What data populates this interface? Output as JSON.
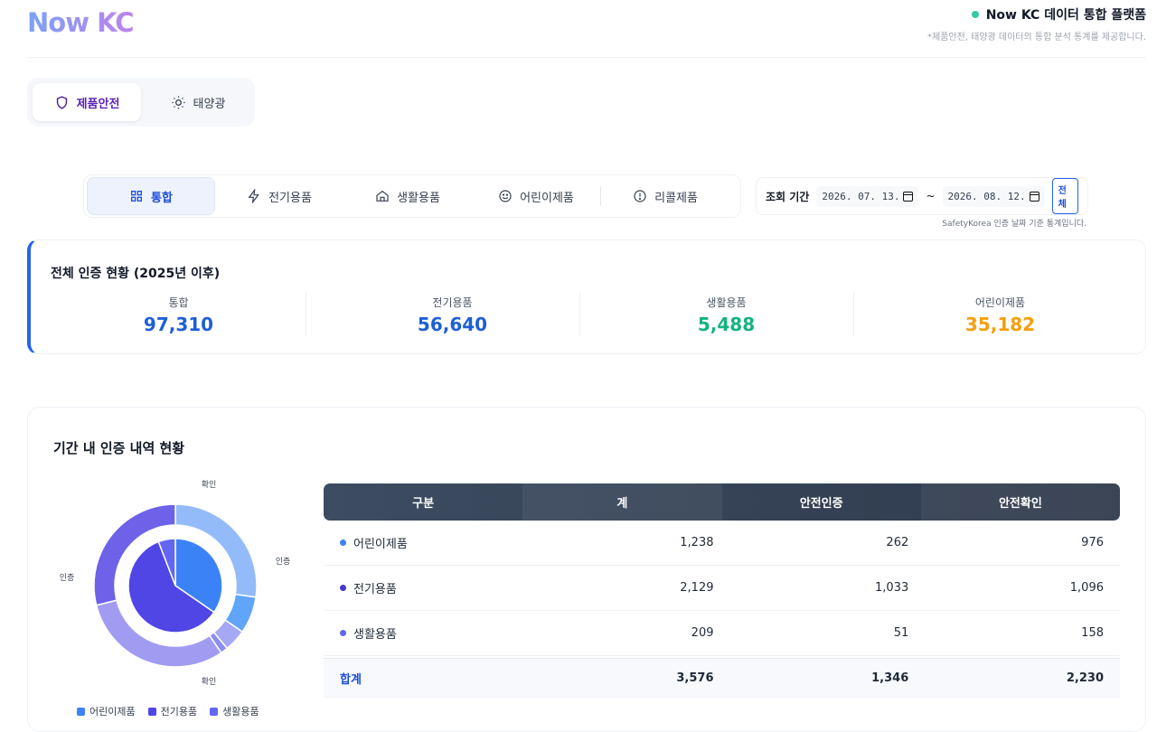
{
  "header": {
    "logo": "Now KC",
    "platform": "Now KC 데이터 통합 플랫폼",
    "subtitle": "*제품안전, 태양광 데이터의 통합 분석 통계를 제공합니다."
  },
  "domain_tabs": [
    {
      "label": "제품안전",
      "icon": "shield-icon",
      "active": true
    },
    {
      "label": "태양광",
      "icon": "sun-icon",
      "active": false
    }
  ],
  "category_tabs": [
    {
      "label": "통합",
      "icon": "grid-icon",
      "active": true
    },
    {
      "label": "전기용품",
      "icon": "lightning-icon"
    },
    {
      "label": "생활용품",
      "icon": "home-icon"
    },
    {
      "label": "어린이제품",
      "icon": "smile-icon"
    },
    {
      "label": "리콜제품",
      "icon": "alert-icon"
    }
  ],
  "period": {
    "label": "조회 기간",
    "start": "2026. 07. 13.",
    "end": "2026. 08. 12.",
    "separator": "~",
    "all_button": "전체",
    "note": "SafetyKorea 인증 날짜 기준 통계입니다."
  },
  "summary": {
    "title": "전체 인증 현황 (2025년 이후)",
    "stats": [
      {
        "label": "통합",
        "value": "97,310",
        "color": "#1d5fd6"
      },
      {
        "label": "전기용품",
        "value": "56,640",
        "color": "#1d5fd6"
      },
      {
        "label": "생활용품",
        "value": "5,488",
        "color": "#14b37d"
      },
      {
        "label": "어린이제품",
        "value": "35,182",
        "color": "#f59e0b"
      }
    ]
  },
  "detail": {
    "title": "기간 내 인증 내역 현황",
    "chart_labels": {
      "top": "확인",
      "right": "인증",
      "left": "인증",
      "bottom": "확인"
    },
    "legend": [
      {
        "label": "어린이제품",
        "color": "#3b82f6"
      },
      {
        "label": "전기용품",
        "color": "#4f46e5"
      },
      {
        "label": "생활용품",
        "color": "#6366f1"
      }
    ],
    "table": {
      "headers": [
        "구분",
        "계",
        "안전인증",
        "안전확인"
      ],
      "rows": [
        {
          "name": "어린이제품",
          "total": "1,238",
          "cert": "262",
          "confirm": "976",
          "color": "#3b82f6"
        },
        {
          "name": "전기용품",
          "total": "2,129",
          "cert": "1,033",
          "confirm": "1,096",
          "color": "#4338ca"
        },
        {
          "name": "생활용품",
          "total": "209",
          "cert": "51",
          "confirm": "158",
          "color": "#6366f1"
        }
      ],
      "total": {
        "name": "합계",
        "total": "3,576",
        "cert": "1,346",
        "confirm": "2,230"
      }
    }
  },
  "chart_data": {
    "type": "pie",
    "inner": [
      {
        "name": "어린이제품",
        "value": 1238,
        "color": "#3b82f6"
      },
      {
        "name": "전기용품",
        "value": 2129,
        "color": "#4f46e5"
      },
      {
        "name": "생활용품",
        "value": 209,
        "color": "#6366f1"
      }
    ],
    "outer": [
      {
        "category": "어린이제품",
        "type": "확인",
        "value": 976,
        "color": "#93bbfa"
      },
      {
        "category": "어린이제품",
        "type": "인증",
        "value": 262,
        "color": "#60a5fa"
      },
      {
        "category": "생활용품",
        "type": "확인",
        "value": 158,
        "color": "#a5a8f5"
      },
      {
        "category": "생활용품",
        "type": "인증",
        "value": 51,
        "color": "#8b8ef2"
      },
      {
        "category": "전기용품",
        "type": "확인",
        "value": 1096,
        "color": "#a19cf2"
      },
      {
        "category": "전기용품",
        "type": "인증",
        "value": 1033,
        "color": "#6d62e8"
      }
    ]
  }
}
